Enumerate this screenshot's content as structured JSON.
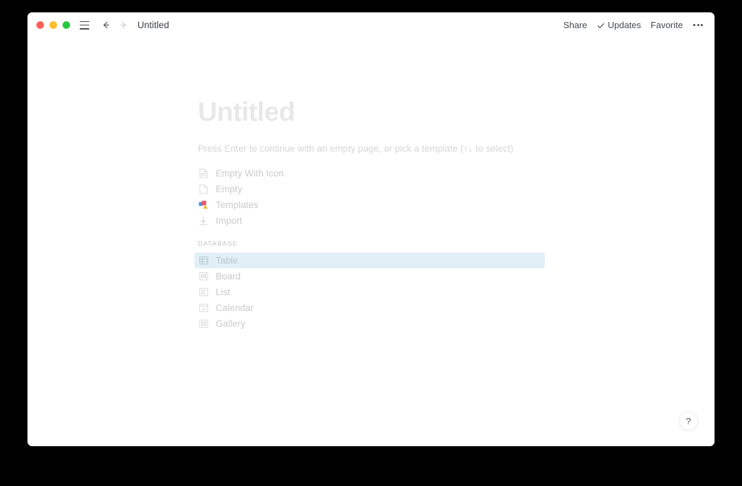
{
  "window": {
    "titlebar": {
      "traffic_lights": [
        "close",
        "minimize",
        "maximize"
      ],
      "menu_icon": "hamburger-icon",
      "back_arrow": "←",
      "forward_arrow": "→",
      "doc_title": "Untitled",
      "actions": {
        "share": "Share",
        "updates": "Updates",
        "updates_check": "✓",
        "favorite": "Favorite",
        "more": "•••"
      }
    }
  },
  "page": {
    "title_placeholder": "Untitled",
    "hint": "Press Enter to continue with an empty page, or pick a template (↑↓ to select)",
    "options": [
      {
        "label": "Empty With Icon",
        "icon": "document-lines-icon"
      },
      {
        "label": "Empty",
        "icon": "document-blank-icon"
      },
      {
        "label": "Templates",
        "icon": "templates-shapes-icon"
      },
      {
        "label": "Import",
        "icon": "download-icon"
      }
    ],
    "database_section_label": "DATABASE",
    "database_options": [
      {
        "label": "Table",
        "icon": "table-grid-icon",
        "selected": true
      },
      {
        "label": "Board",
        "icon": "board-columns-icon",
        "selected": false
      },
      {
        "label": "List",
        "icon": "list-lines-icon",
        "selected": false
      },
      {
        "label": "Calendar",
        "icon": "calendar-31-icon",
        "selected": false
      },
      {
        "label": "Gallery",
        "icon": "gallery-grid-icon",
        "selected": false
      }
    ],
    "help_label": "?"
  },
  "colors": {
    "selection": "#e1eff7",
    "muted_text": "#c9cacb",
    "title_placeholder": "#e8e8e8"
  }
}
